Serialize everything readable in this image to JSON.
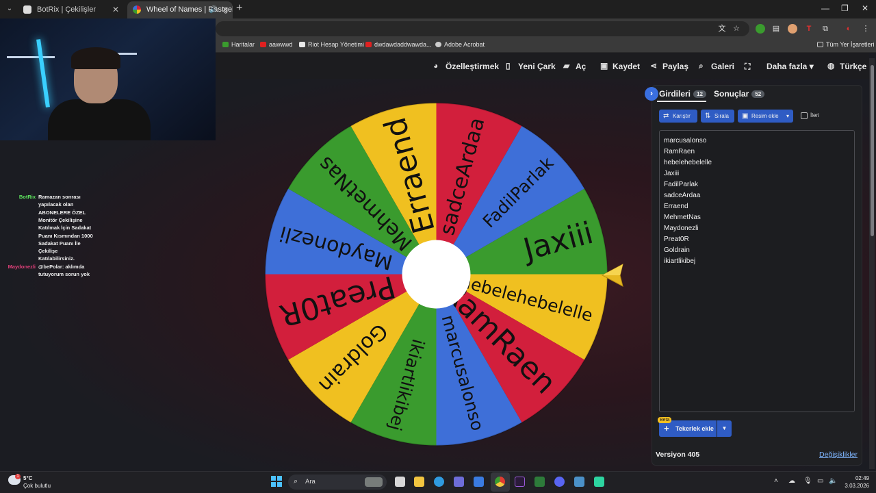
{
  "browser": {
    "tabs": [
      {
        "title": "BotRix | Çekilişler",
        "active": false
      },
      {
        "title": "Wheel of Names | Rastgele",
        "active": true
      }
    ],
    "bookmarks": [
      "Haritalar",
      "aawwwd",
      "Riot Hesap Yönetimi",
      "dwdawdaddwawda...",
      "Adobe Acrobat"
    ],
    "all_bookmarks": "Tüm Yer İşaretleri"
  },
  "site_nav": {
    "customize": "Özelleştirmek",
    "new_wheel": "Yeni Çark",
    "open": "Aç",
    "save": "Kaydet",
    "share": "Paylaş",
    "gallery": "Galeri",
    "more": "Daha fazla",
    "language": "Türkçe"
  },
  "chat": [
    {
      "user": "BotRix",
      "color": "#5ee35e",
      "lines": [
        "Ramazan sonrası",
        "yapılacak olan",
        "ABONELERE ÖZEL",
        "Monitör Çekilişine",
        "Katılmak İçin Sadakat",
        "Puanı Kısmından 1000",
        "Sadakat Puanı İle",
        "Çekilişe",
        "Katılabilirsiniz."
      ]
    },
    {
      "user": "Maydonezli",
      "color": "#e0407a",
      "lines": [
        "@bePolar: aklımda",
        "tutuyorum sorun yok"
      ]
    }
  ],
  "wheel": {
    "segments": [
      {
        "label": "Jaxiii",
        "color": "#3a9b2e"
      },
      {
        "label": "hebelehebelelle",
        "color": "#f0c020"
      },
      {
        "label": "RamRaen",
        "color": "#d21f3c"
      },
      {
        "label": "marcusalonso",
        "color": "#3e6fd8"
      },
      {
        "label": "ikiartlikibej",
        "color": "#3a9b2e"
      },
      {
        "label": "Goldrain",
        "color": "#f0c020"
      },
      {
        "label": "Preat0R",
        "color": "#d21f3c"
      },
      {
        "label": "Maydonezli",
        "color": "#3e6fd8"
      },
      {
        "label": "MehmetNas",
        "color": "#3a9b2e"
      },
      {
        "label": "Erraend",
        "color": "#f0c020"
      },
      {
        "label": "sadceArdaa",
        "color": "#d21f3c"
      },
      {
        "label": "FadilParlak",
        "color": "#3e6fd8"
      }
    ]
  },
  "panel": {
    "entries_tab": "Girdileri",
    "entries_count": "12",
    "results_tab": "Sonuçlar",
    "results_count": "52",
    "shuffle": "Karıştır",
    "sort": "Sırala",
    "add_image": "Resim ekle",
    "advanced": "İleri",
    "entries": [
      "marcusalonso",
      "RamRaen",
      "hebelehebelelle",
      "Jaxiii",
      "FadilParlak",
      "sadceArdaa",
      "Erraend",
      "MehmetNas",
      "Maydonezli",
      "Preat0R",
      "Goldrain",
      "ikiartlikibej"
    ],
    "beta": "Beta",
    "add_wheel": "Tekerlek ekle",
    "version": "Versiyon 405",
    "changes": "Değişiklikler"
  },
  "taskbar": {
    "temperature": "5°C",
    "weather": "Çok bulutlu",
    "weather_badge": "1",
    "search": "Ara",
    "time": "02:49",
    "date": "3.03.2026"
  }
}
